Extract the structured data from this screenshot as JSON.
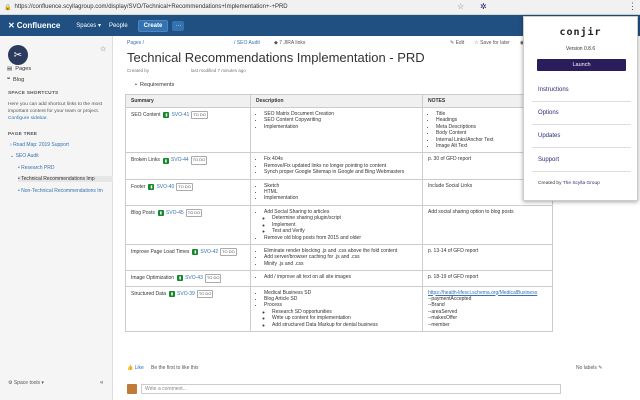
{
  "browser": {
    "url": "https://confluence.scyllagroup.com/display/SVO/Technical+Recommendations+Implementation+-+PRD"
  },
  "topnav": {
    "logo": "Confluence",
    "spaces": "Spaces ▾",
    "people": "People",
    "create": "Create",
    "more": "···"
  },
  "sidebar": {
    "pages": "Pages",
    "blog": "Blog",
    "shortcuts_head": "SPACE SHORTCUTS",
    "shortcuts_text": "Here you can add shortcut links to the most important content for your team or project.",
    "configure": "Configure sidebar.",
    "tree_head": "PAGE TREE",
    "tree": [
      "Road Map: 2019 Support",
      "SEO Audit",
      "Research PRD",
      "Technical Recommendations Imp",
      "Non-Technical Recommendations Im"
    ],
    "space_tools": "Space tools ▾"
  },
  "page": {
    "breadcrumb1": "Pages /",
    "breadcrumb2": "/ SEO Audit",
    "jira_links": "7 JIRA links",
    "edit": "Edit",
    "save_later": "Save for later",
    "title": "Technical Recommendations Implementation - PRD",
    "created_by": "Created by",
    "modified": "last modified 7 minutes ago",
    "requirements": "Requirements",
    "headers": [
      "Summary",
      "Description",
      "NOTES"
    ],
    "rows": [
      {
        "summary": "SEO Content",
        "key": "SVO-41",
        "status": "TO DO",
        "desc": [
          "SEO Matrix Document Creation",
          "SEO Content Copywriting",
          "Implementation"
        ],
        "notes": [
          "Title",
          "Headings",
          "Meta Descriptions",
          "Body Content",
          "Internal Links/Anchor Text",
          "Image Alt Text"
        ],
        "notes_type": "list"
      },
      {
        "summary": "Broken Links",
        "key": "SVO-44",
        "status": "TO DO",
        "desc": [
          "Fix 404s",
          "Remove/Fix updated links no longer pointing to content",
          "Synch proper Google Sitemap in Google and Bing Webmasters"
        ],
        "notes": [
          "p. 30 of GFD report"
        ],
        "notes_type": "text"
      },
      {
        "summary": "Footer",
        "key": "SVO-40",
        "status": "TO DO",
        "desc": [
          "Sketch",
          "HTML",
          "Implementation"
        ],
        "notes": [
          "Include Social Links"
        ],
        "notes_type": "text"
      },
      {
        "summary": "Blog Posts",
        "key": "SVO-45",
        "status": "TO DO",
        "desc": [
          "Add Social Sharing to articles"
        ],
        "desc_sub": [
          "Determine sharing plugin/script",
          "Implement",
          "Test and Verify"
        ],
        "desc_after": [
          "Remove old blog posts from 2015 and older"
        ],
        "notes": [
          "Add social sharing option to blog posts"
        ],
        "notes_type": "text"
      },
      {
        "summary": "Improve Page Load Times",
        "key": "SVO-42",
        "status": "TO DO",
        "desc": [
          "Eliminate render blocking .js and .css above the fold content",
          "Add server/browser caching for .js and .css",
          "Minify .js and .css"
        ],
        "notes": [
          "p. 13-14 of GFD report"
        ],
        "notes_type": "text"
      },
      {
        "summary": "Image Optimization",
        "key": "SVO-43",
        "status": "TO DO",
        "desc": [
          "Add / improve alt text on all site images"
        ],
        "notes": [
          "p. 18-19 of GFD report"
        ],
        "notes_type": "text"
      },
      {
        "summary": "Structured Data",
        "key": "SVO-39",
        "status": "TO DO",
        "desc": [
          "Medical Business SD",
          "Blog Article SD",
          "Process"
        ],
        "desc_sub": [
          "Research SD opportunities",
          "Write up content for implementation",
          "Add structured Data Markup for dental business"
        ],
        "notes": [
          "https://health-lifesci.schema.org/MedicalBusiness",
          "--paymentAccepted",
          "--Brand",
          "--areaServed",
          "--makesOffer",
          "--member"
        ],
        "notes_type": "schema"
      }
    ],
    "like": "Like",
    "like_text": "Be the first to like this",
    "no_labels": "No labels",
    "comment_placeholder": "Write a comment..."
  },
  "popup": {
    "title": "conjir",
    "version": "Version 0.8.6",
    "launch": "Launch",
    "links": [
      "Instructions",
      "Options",
      "Updates",
      "Support"
    ],
    "created_by": "Created by",
    "company": "The Scylla Group"
  },
  "colors": {
    "topnav": "#205081",
    "launch": "#2a1d5c",
    "link": "#3572b0"
  }
}
